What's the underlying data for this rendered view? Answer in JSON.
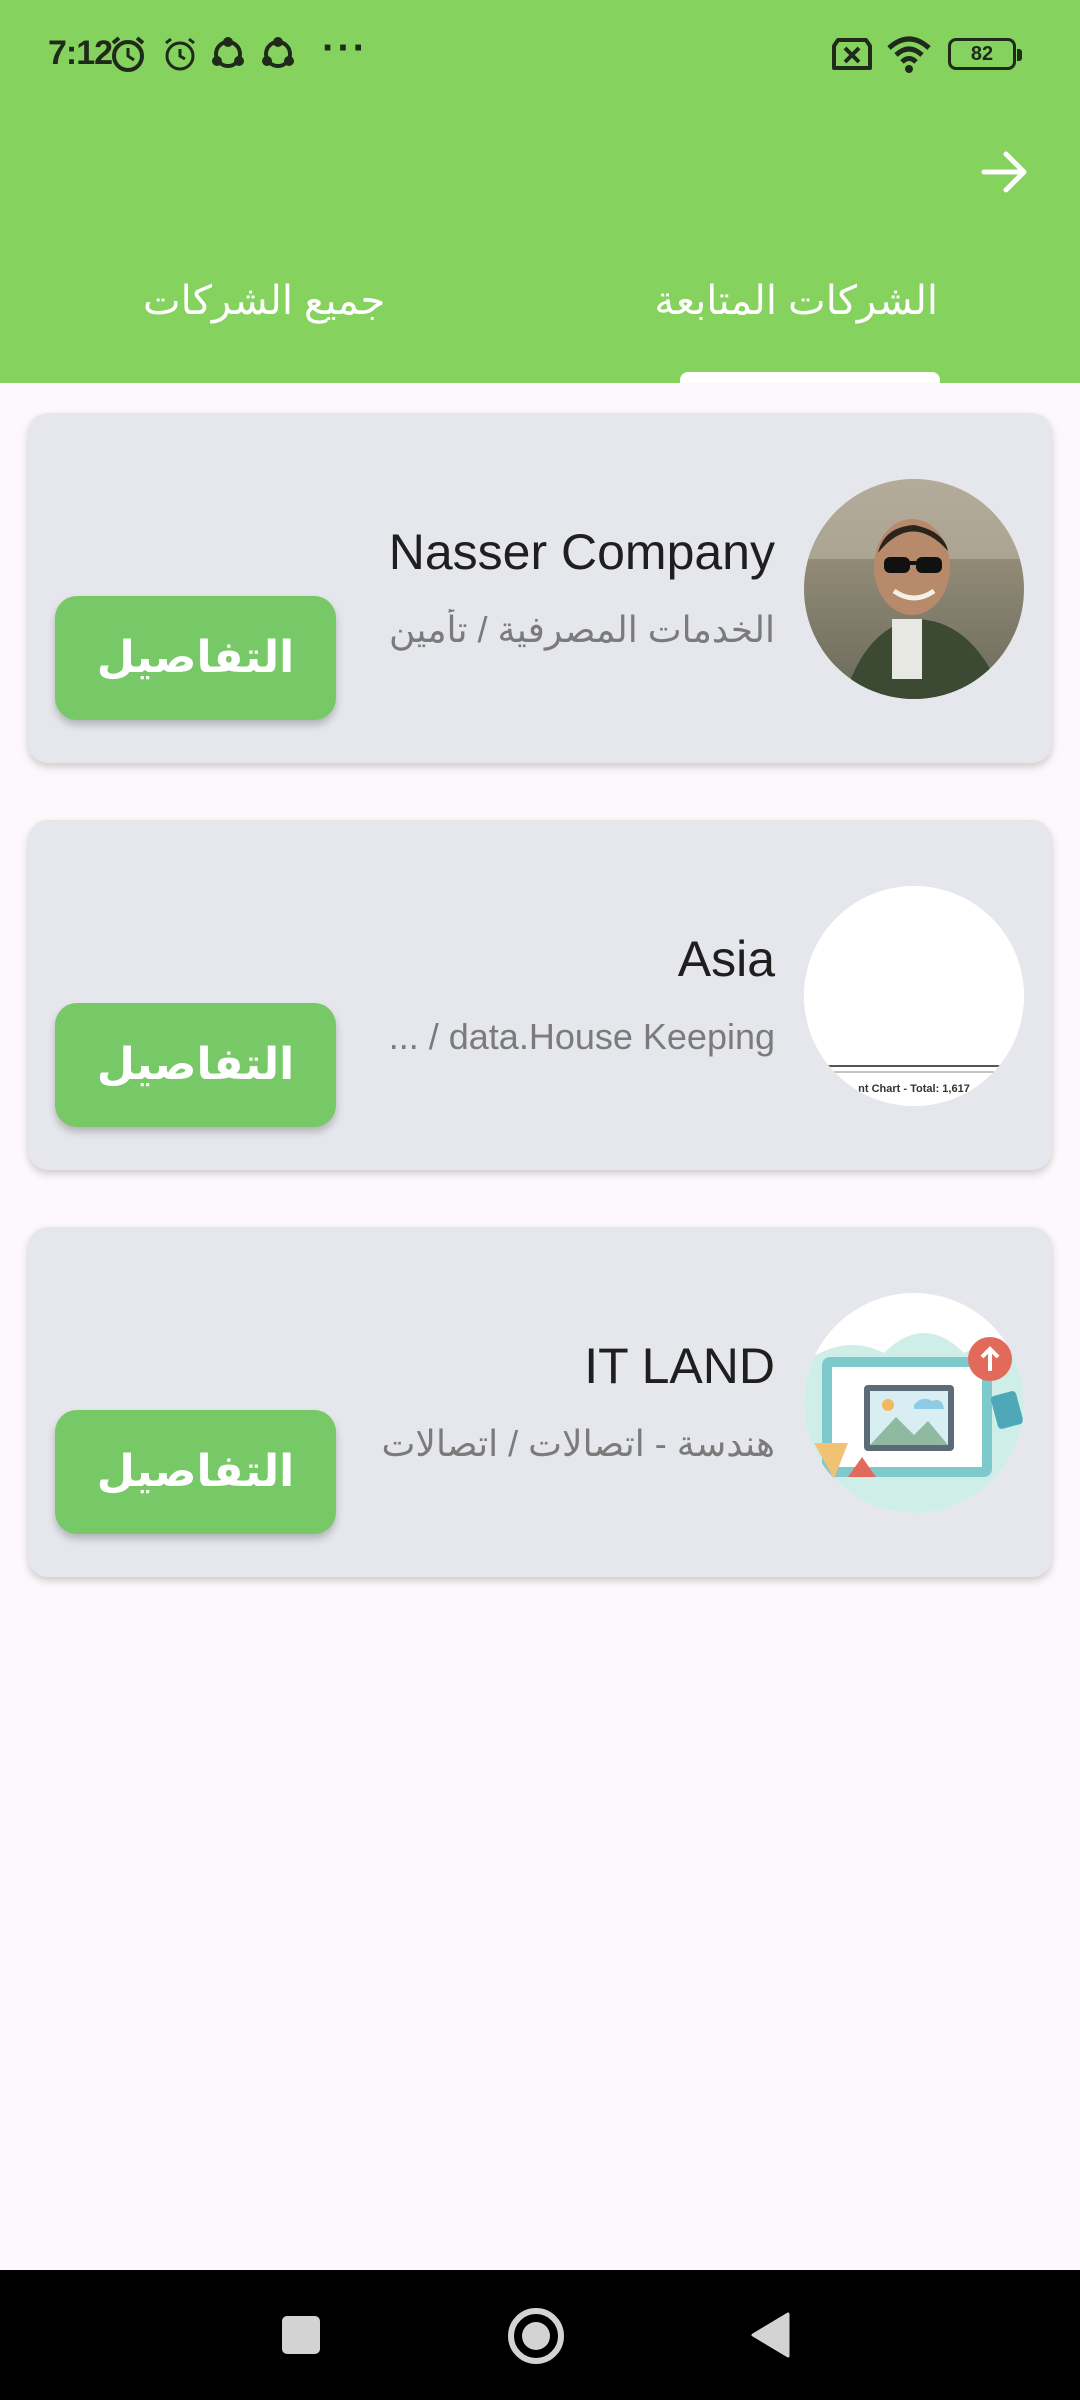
{
  "status_bar": {
    "time": "7:12",
    "battery": "82",
    "more_dots": "···"
  },
  "tabs": [
    {
      "label": "الشركات المتابعة",
      "selected": true
    },
    {
      "label": "جميع الشركات",
      "selected": false
    }
  ],
  "companies": [
    {
      "name": "Nasser Company",
      "category": "الخدمات المصرفية / تأمين",
      "button_label": "التفاصيل"
    },
    {
      "name": "Asia",
      "category": "data.House Keeping / ...",
      "button_label": "التفاصيل",
      "avatar_caption": "nt Chart - Total: 1,617"
    },
    {
      "name": "IT LAND",
      "category": "هندسة - اتصالات / اتصالات",
      "button_label": "التفاصيل"
    }
  ],
  "colors": {
    "header": "#86d25f",
    "button": "#77c866",
    "card": "#e5e7ec",
    "background": "#fdf8fb"
  }
}
